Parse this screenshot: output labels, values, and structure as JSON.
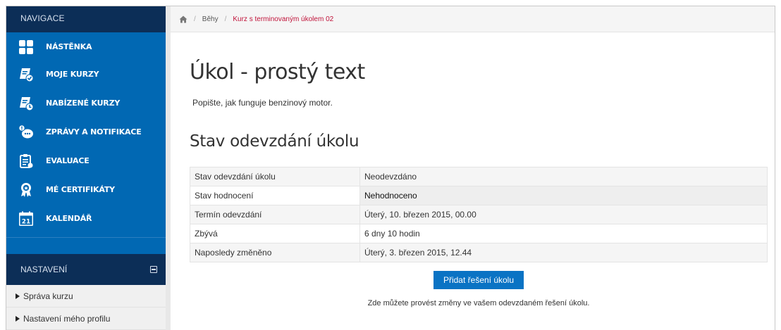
{
  "navigation": {
    "header": "NAVIGACE",
    "items": [
      {
        "label": "NÁSTĚNKA",
        "icon": "dashboard-icon"
      },
      {
        "label": "MOJE KURZY",
        "icon": "my-courses-icon"
      },
      {
        "label": "NABÍZENÉ KURZY",
        "icon": "offered-courses-icon"
      },
      {
        "label": "ZPRÁVY A NOTIFIKACE",
        "icon": "messages-icon"
      },
      {
        "label": "EVALUACE",
        "icon": "evaluation-icon"
      },
      {
        "label": "MÉ CERTIFIKÁTY",
        "icon": "certificate-icon"
      },
      {
        "label": "KALENDÁŘ",
        "icon": "calendar-icon",
        "calendar_day": "21"
      }
    ]
  },
  "settings": {
    "header": "NASTAVENÍ",
    "items": [
      {
        "label": "Správa kurzu"
      },
      {
        "label": "Nastavení mého profilu"
      }
    ]
  },
  "breadcrumb": {
    "home_icon": "home-icon",
    "items": [
      "Běhy",
      "Kurz s terminovaným úkolem 02"
    ]
  },
  "main": {
    "title": "Úkol - prostý text",
    "description": "Popište, jak funguje benzinový motor.",
    "status_title": "Stav odevzdání úkolu",
    "status_rows": [
      {
        "key": "Stav odevzdání úkolu",
        "value": "Neodevzdáno"
      },
      {
        "key": "Stav hodnocení",
        "value": "Nehodnoceno"
      },
      {
        "key": "Termín odevzdání",
        "value": "Úterý, 10. březen 2015, 00.00"
      },
      {
        "key": "Zbývá",
        "value": "6 dny 10 hodin"
      },
      {
        "key": "Naposledy změněno",
        "value": "Úterý, 3. březen 2015, 12.44"
      }
    ],
    "add_submission_button": "Přidat řešení úkolu",
    "hint": "Zde můžete provést změny ve vašem odevzdaném řešení úkolu."
  },
  "colors": {
    "nav_blue": "#0168b3",
    "nav_dark": "#0c2e57",
    "accent_red": "#c0133a",
    "button_blue": "#0a73c4"
  }
}
